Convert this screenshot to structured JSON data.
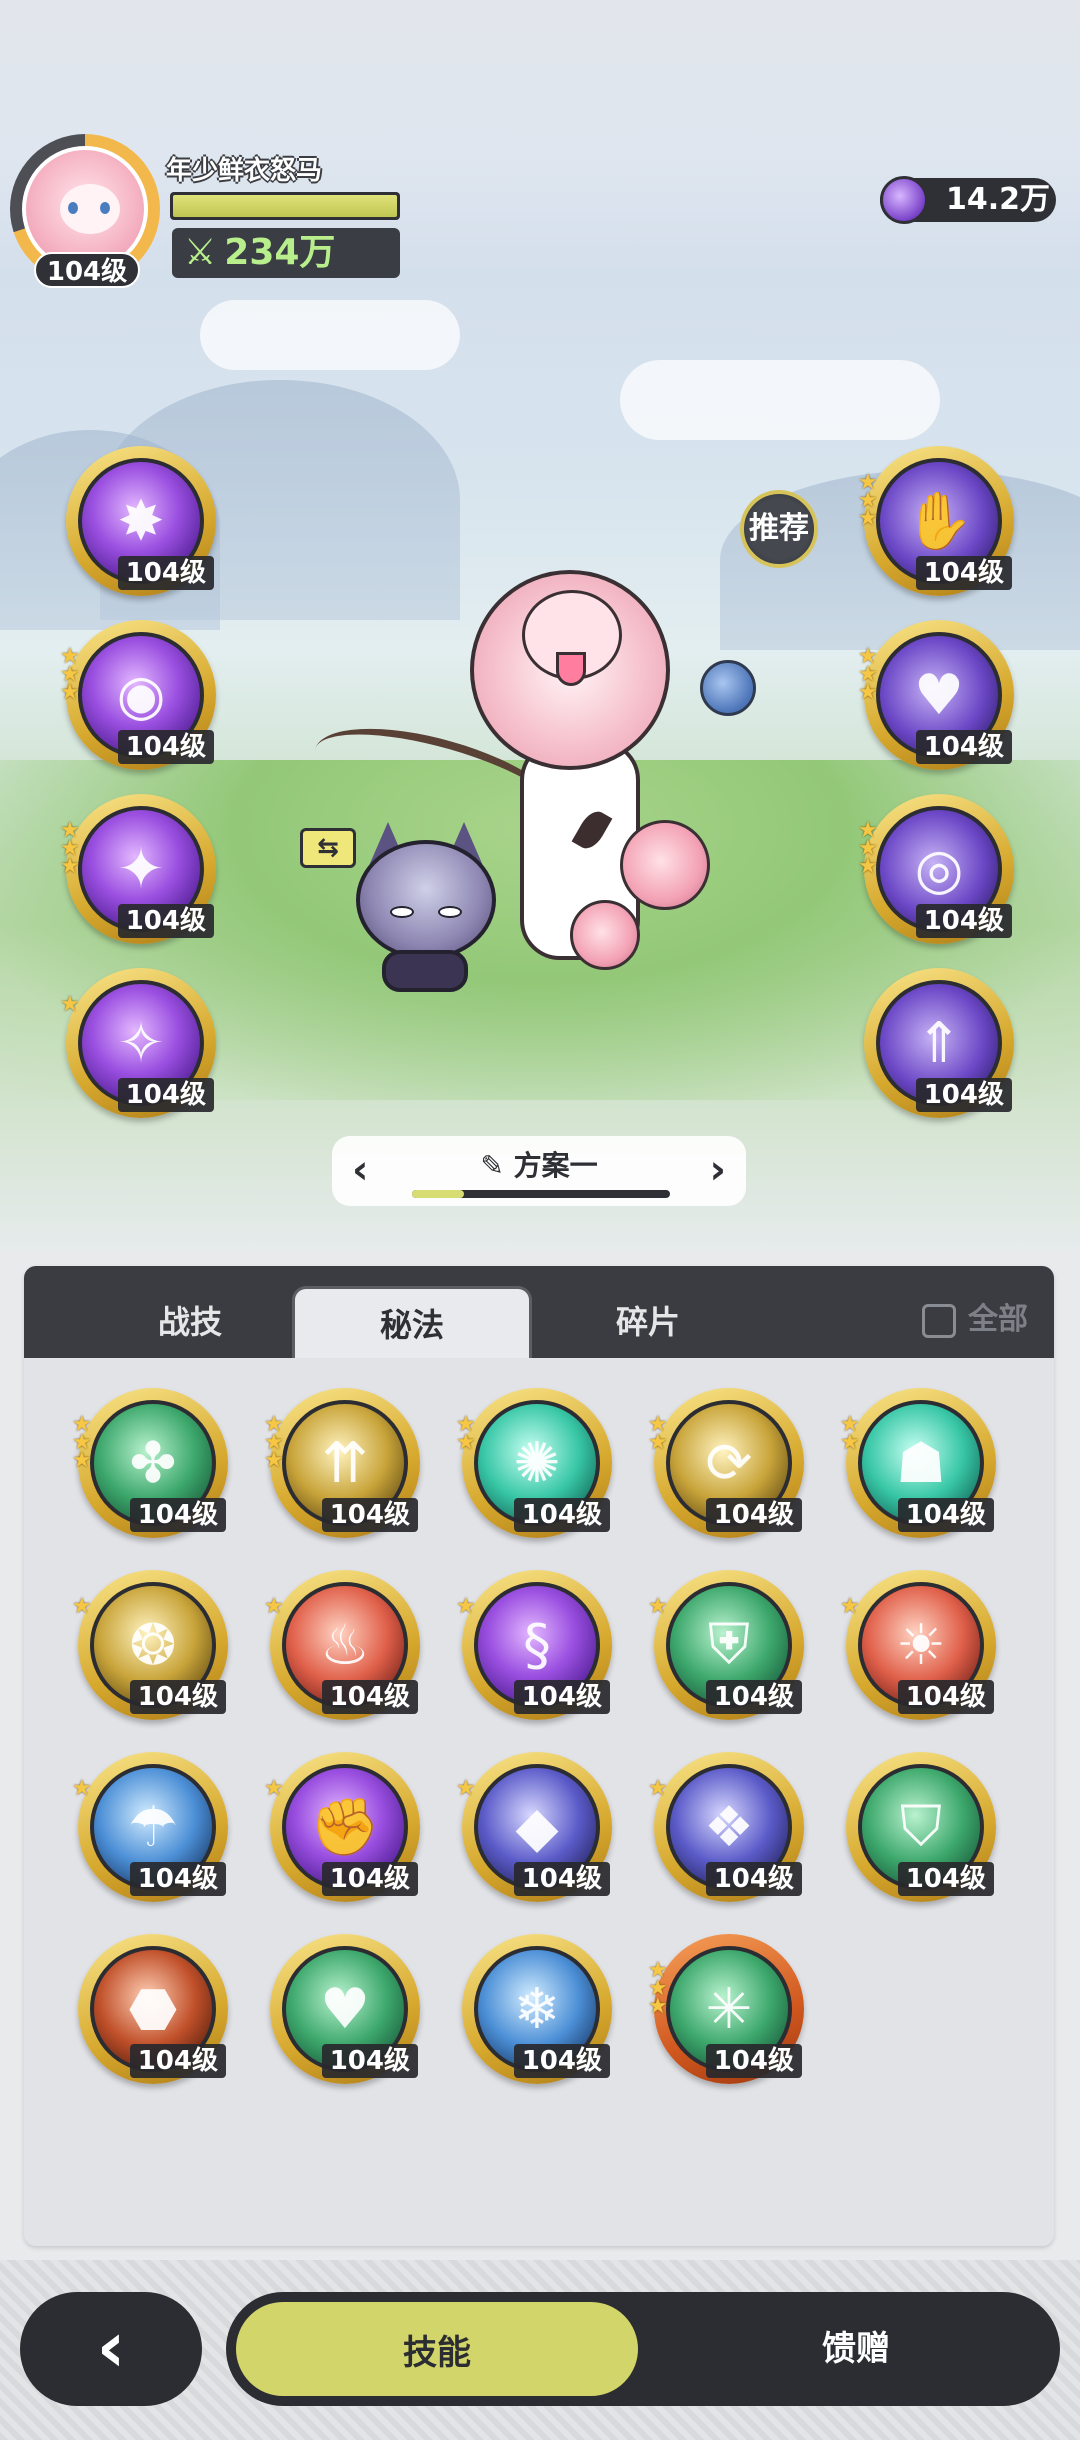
{
  "player": {
    "name": "年少鲜衣怒马",
    "level": "104级",
    "power": "234万"
  },
  "currency": {
    "amount": "14.2万",
    "icon": "purple-gem-icon"
  },
  "recommend_label": "推荐",
  "left_skills": [
    {
      "level": "104级",
      "stars": 0,
      "color": "purple",
      "icon": "burst-icon"
    },
    {
      "level": "104级",
      "stars": 3,
      "color": "purple",
      "icon": "eye-icon"
    },
    {
      "level": "104级",
      "stars": 3,
      "color": "purple",
      "icon": "sparkle-icon"
    },
    {
      "level": "104级",
      "stars": 1,
      "color": "purple",
      "icon": "star-burst-icon"
    }
  ],
  "right_skills": [
    {
      "level": "104级",
      "stars": 3,
      "color": "violet",
      "icon": "hand-icon"
    },
    {
      "level": "104级",
      "stars": 3,
      "color": "violet",
      "icon": "heart-cloak-icon"
    },
    {
      "level": "104级",
      "stars": 3,
      "color": "violet",
      "icon": "hooded-eye-icon"
    },
    {
      "level": "104级",
      "stars": 0,
      "color": "violet",
      "icon": "arrow-figure-icon"
    }
  ],
  "plan": {
    "label": "方案一",
    "progress": 0.2
  },
  "tabs": {
    "tab1": "战技",
    "tab2": "秘法",
    "tab3": "碎片",
    "all": "全部",
    "active": "秘法"
  },
  "grid_items": [
    {
      "level": "104级",
      "stars": 3,
      "color": "green",
      "icon": "wing-star-icon"
    },
    {
      "level": "104级",
      "stars": 3,
      "color": "gold",
      "icon": "arrows-up-icon"
    },
    {
      "level": "104级",
      "stars": 2,
      "color": "teal",
      "icon": "swirl-icon"
    },
    {
      "level": "104级",
      "stars": 2,
      "color": "gold",
      "icon": "arrow-cycle-icon"
    },
    {
      "level": "104级",
      "stars": 2,
      "color": "teal",
      "icon": "figure-icon"
    },
    {
      "level": "104级",
      "stars": 1,
      "color": "gold",
      "icon": "wheel-icon"
    },
    {
      "level": "104级",
      "stars": 1,
      "color": "red",
      "icon": "flame-wave-icon"
    },
    {
      "level": "104级",
      "stars": 1,
      "color": "purple",
      "icon": "spiral-icon"
    },
    {
      "level": "104级",
      "stars": 1,
      "color": "green",
      "icon": "armor-icon"
    },
    {
      "level": "104级",
      "stars": 1,
      "color": "red",
      "icon": "fire-figure-icon"
    },
    {
      "level": "104级",
      "stars": 1,
      "color": "blue",
      "icon": "water-figure-icon"
    },
    {
      "level": "104级",
      "stars": 1,
      "color": "purple",
      "icon": "fist-icon"
    },
    {
      "level": "104级",
      "stars": 1,
      "color": "indigo",
      "icon": "diamond-icon"
    },
    {
      "level": "104级",
      "stars": 1,
      "color": "indigo",
      "icon": "gem-armor-icon"
    },
    {
      "level": "104级",
      "stars": 0,
      "color": "green",
      "icon": "shield-icon"
    },
    {
      "level": "104级",
      "stars": 0,
      "color": "rust",
      "icon": "rock-icon"
    },
    {
      "level": "104级",
      "stars": 0,
      "color": "green",
      "icon": "heart-icon"
    },
    {
      "level": "104级",
      "stars": 0,
      "color": "blue",
      "icon": "ice-shard-icon"
    },
    {
      "level": "104级",
      "stars": 3,
      "color": "green",
      "icon": "sparkle-star-icon",
      "frame": "orange"
    }
  ],
  "bottom": {
    "tab_skill": "技能",
    "tab_gift": "馈赠",
    "active": "技能"
  }
}
